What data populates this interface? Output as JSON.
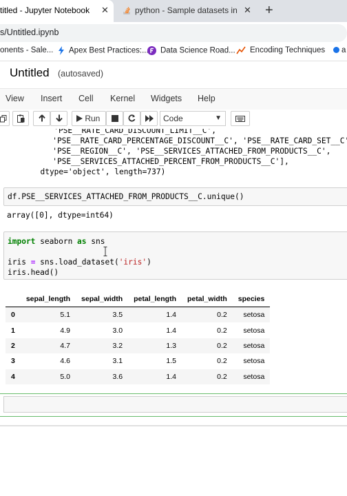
{
  "browser": {
    "tabs": [
      {
        "title": "titled - Jupyter Notebook",
        "close": "✕"
      },
      {
        "title": "python - Sample datasets in Pand",
        "close": "✕"
      }
    ],
    "new_tab": "+",
    "url": "s/Untitled.ipynb",
    "bookmarks": [
      {
        "label": "onents - Sale..."
      },
      {
        "label": "Apex Best Practices:..."
      },
      {
        "label": "Data Science Road..."
      },
      {
        "label": "Encoding Techniques"
      },
      {
        "label": "a"
      }
    ]
  },
  "notebook": {
    "title": "Untitled",
    "status": "(autosaved)",
    "menu": [
      "View",
      "Insert",
      "Cell",
      "Kernel",
      "Widgets",
      "Help"
    ],
    "toolbar": {
      "run_label": "Run",
      "cell_type": "Code"
    }
  },
  "cells": {
    "out1_lines": [
      "   'PSE__RATE_CARD_DISCOUNT_LIMIT__C',",
      "   'PSE__RATE_CARD_PERCENTAGE_DISCOUNT__C', 'PSE__RATE_CARD_SET__C',",
      "   'PSE__REGION__C', 'PSE__SERVICES_ATTACHED_FROM_PRODUCTS__C',",
      "   'PSE__SERVICES_ATTACHED_PERCENT_FROM_PRODUCTS__C'],",
      "  dtype='object', length=737)"
    ],
    "in2": "df.PSE__SERVICES_ATTACHED_FROM_PRODUCTS__C.unique()",
    "out2": "array([0], dtype=int64)",
    "in3": {
      "kw_import": "import",
      "mod": " seaborn ",
      "kw_as": "as",
      "alias": " sns",
      "l3a": "iris ",
      "l3op": "=",
      "l3b": " sns.load_dataset(",
      "l3str": "'iris'",
      "l3c": ")",
      "l4": "iris.head()"
    }
  },
  "dataframe": {
    "columns": [
      "",
      "sepal_length",
      "sepal_width",
      "petal_length",
      "petal_width",
      "species"
    ],
    "rows": [
      [
        "0",
        "5.1",
        "3.5",
        "1.4",
        "0.2",
        "setosa"
      ],
      [
        "1",
        "4.9",
        "3.0",
        "1.4",
        "0.2",
        "setosa"
      ],
      [
        "2",
        "4.7",
        "3.2",
        "1.3",
        "0.2",
        "setosa"
      ],
      [
        "3",
        "4.6",
        "3.1",
        "1.5",
        "0.2",
        "setosa"
      ],
      [
        "4",
        "5.0",
        "3.6",
        "1.4",
        "0.2",
        "setosa"
      ]
    ]
  }
}
